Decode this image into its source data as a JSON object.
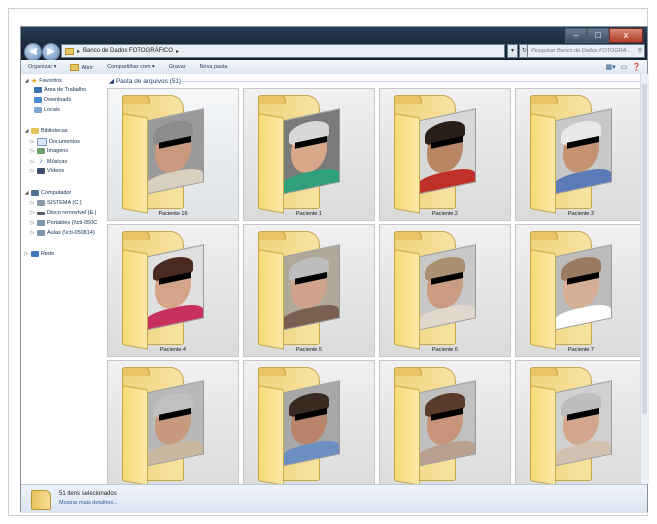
{
  "window": {
    "address": [
      "Banco de Dados FOTOGRÁFICO"
    ],
    "search_placeholder": "Pesquisar Banco de Dados FOTOGRÁ...",
    "controls": [
      "–",
      "□",
      "x"
    ]
  },
  "toolbar": {
    "organize": "Organizar ▾",
    "open": "Abrir",
    "share": "Compartilhar com ▾",
    "burn": "Gravar",
    "new_folder": "Nova pasta"
  },
  "sidebar": {
    "favorites": "Favoritos",
    "fav_items": [
      "Área de Trabalho",
      "Downloads",
      "Locais"
    ],
    "libraries": "Bibliotecas",
    "lib_items": [
      "Documentos",
      "Imagens",
      "Músicas",
      "Vídeos"
    ],
    "computer": "Computador",
    "comp_items": [
      "SISTEMA (C:)",
      "Disco removível (E:)",
      "Portables (\\\\cti-050C",
      "Aulas (\\\\cti-050814)"
    ],
    "network": "Rede"
  },
  "content": {
    "group_header": "Pasta de arquivos (51)",
    "folders": [
      {
        "label": "Paciente 16"
      },
      {
        "label": "Paciente 1"
      },
      {
        "label": "Paciente 2"
      },
      {
        "label": "Paciente 3"
      },
      {
        "label": "Paciente 4"
      },
      {
        "label": "Paciente 5"
      },
      {
        "label": "Paciente 6"
      },
      {
        "label": "Paciente 7"
      },
      {
        "label": ""
      },
      {
        "label": ""
      },
      {
        "label": ""
      },
      {
        "label": ""
      }
    ]
  },
  "status": {
    "count": "51 itens selecionados",
    "details": "Mostrar mais detalhes..."
  },
  "colors": {
    "folder": "#f6d976",
    "selection": "#dadada",
    "link": "#2b5fa0"
  }
}
